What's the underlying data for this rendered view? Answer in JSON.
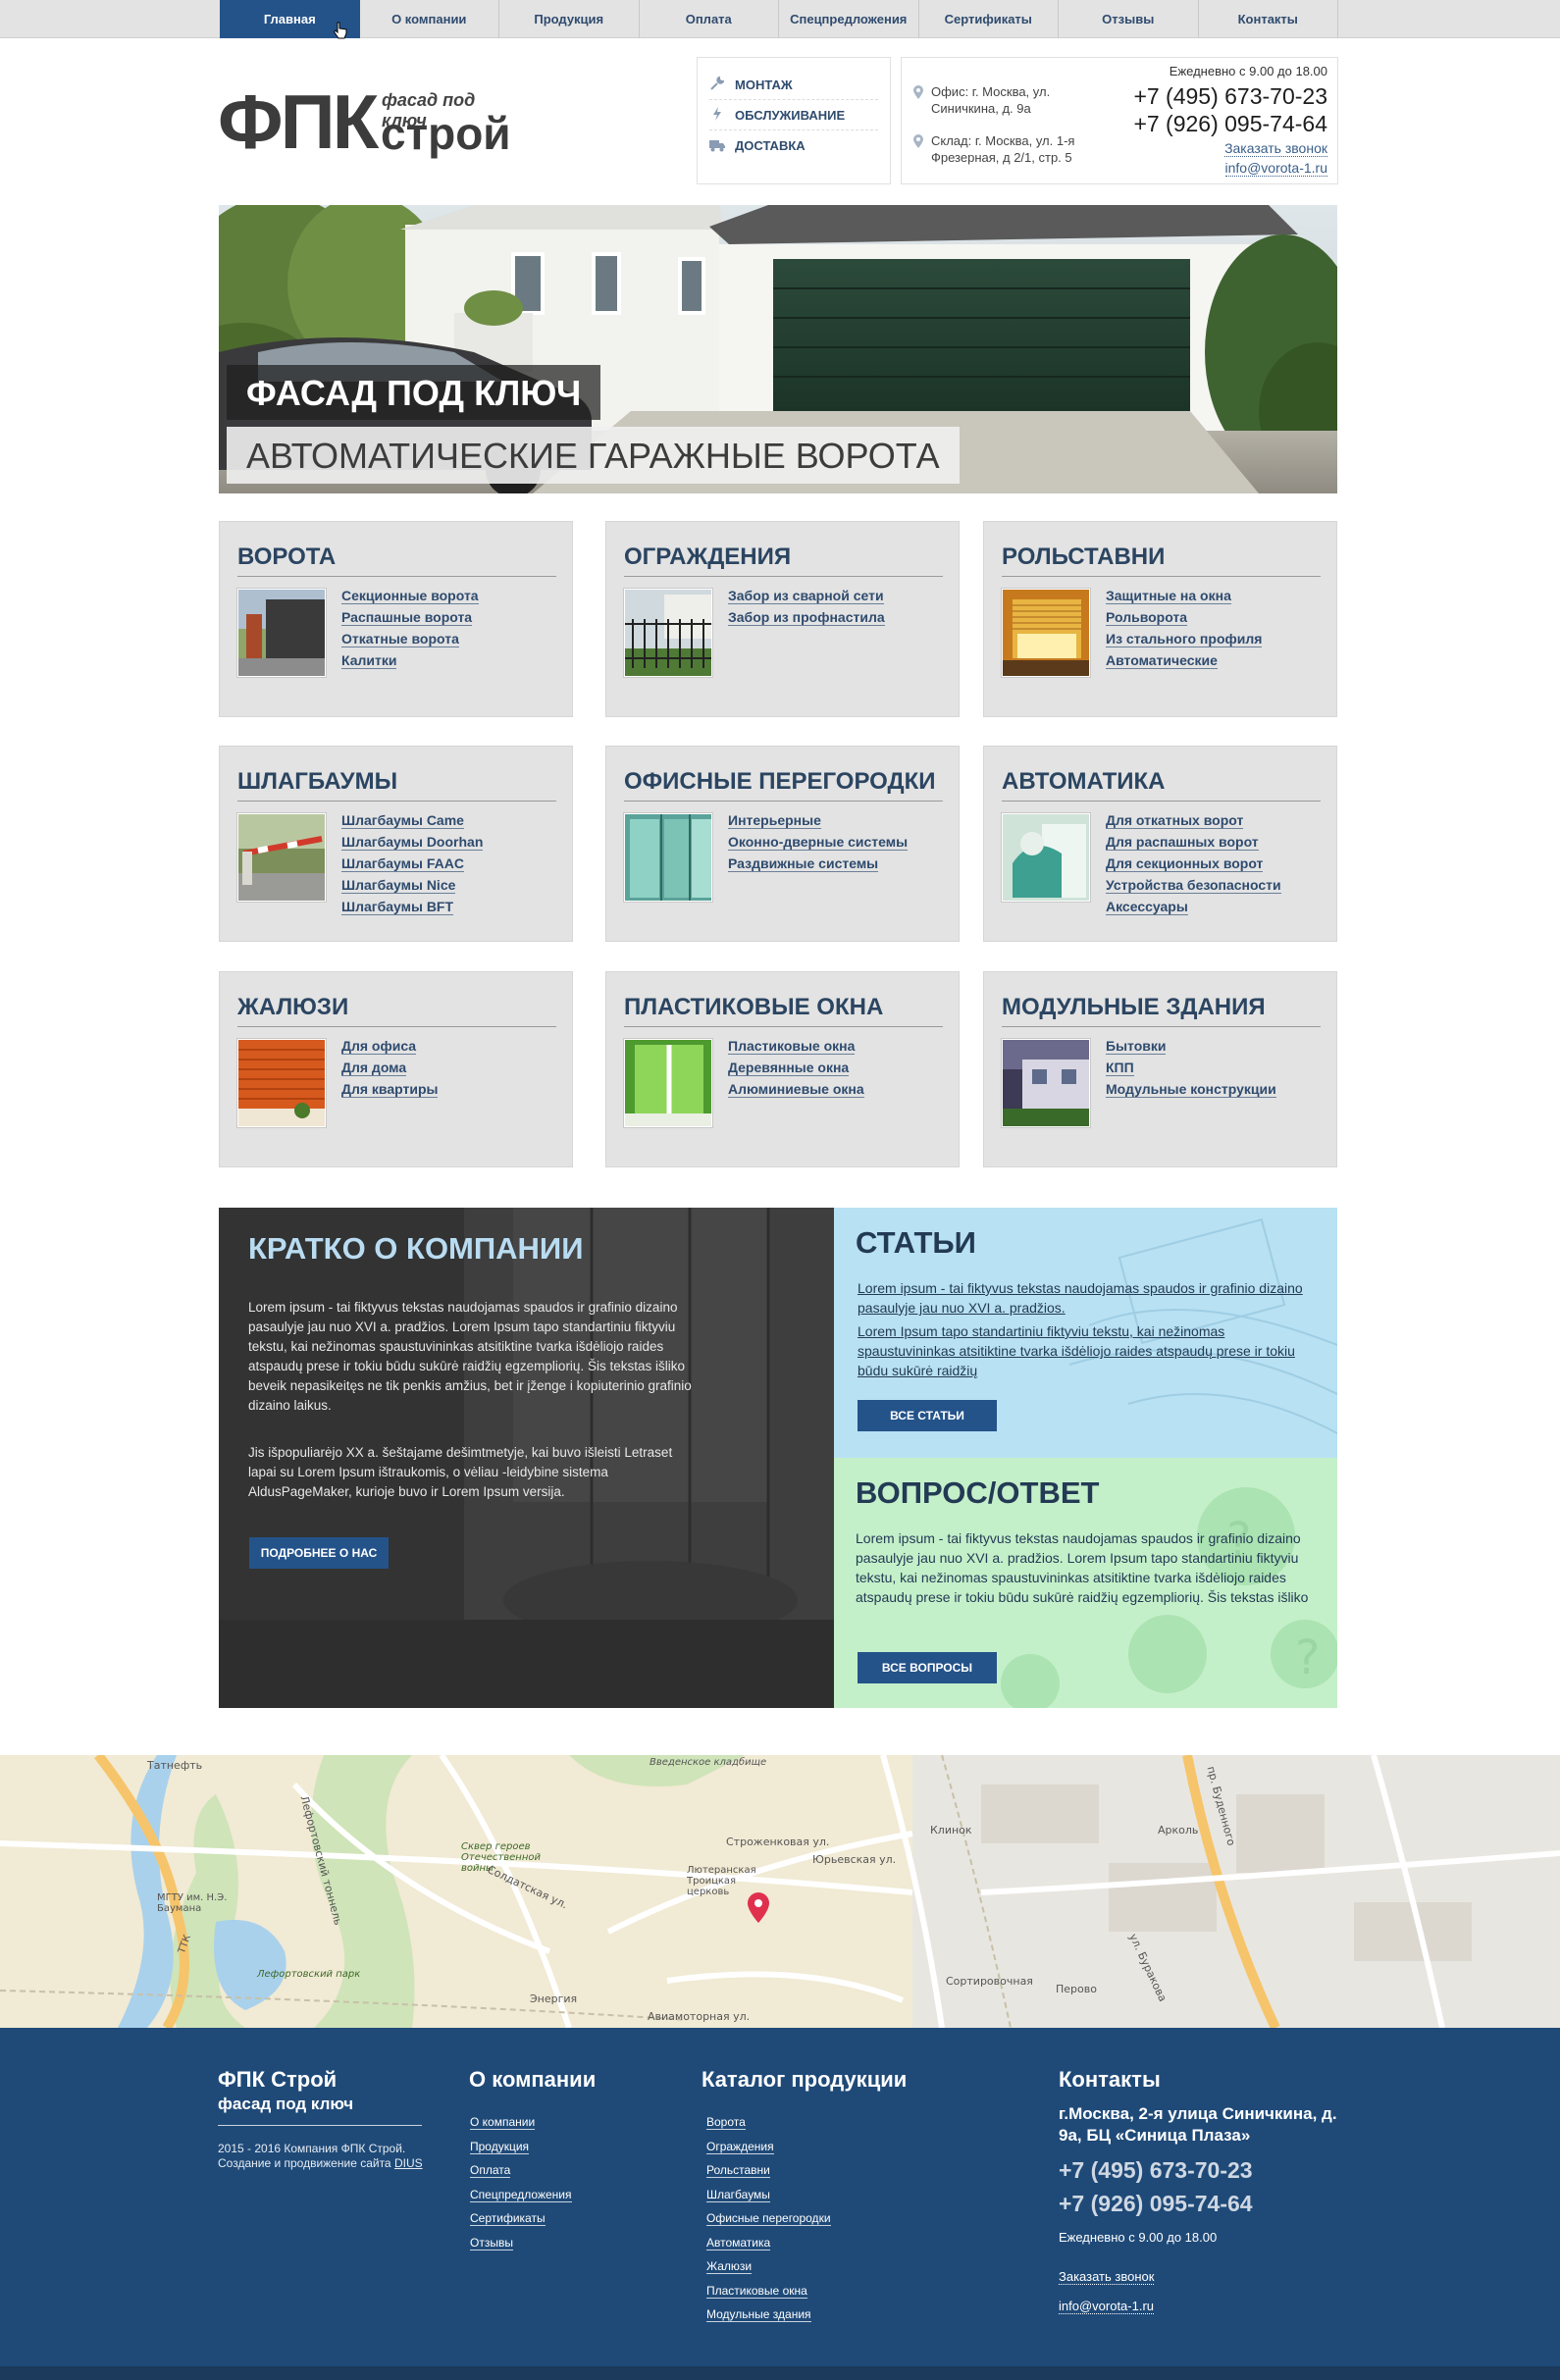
{
  "nav": {
    "items": [
      "Главная",
      "О компании",
      "Продукция",
      "Оплата",
      "Спецпредложения",
      "Сертификаты",
      "Отзывы",
      "Контакты"
    ]
  },
  "logo": {
    "main": "ФПК",
    "sub": "фасад под ключ",
    "stroy": "строй"
  },
  "services": {
    "items": [
      {
        "label": "МОНТАЖ",
        "icon": "wrench-icon"
      },
      {
        "label": "ОБСЛУЖИВАНИЕ",
        "icon": "lightning-icon"
      },
      {
        "label": "ДОСТАВКА",
        "icon": "truck-icon"
      }
    ]
  },
  "header_contacts": {
    "office": "Офис: г. Москва, ул. Синичкина, д. 9а",
    "warehouse": "Склад: г. Москва, ул. 1-я Фрезерная, д 2/1, стр. 5",
    "hours": "Ежедневно с 9.00 до 18.00",
    "phone1": "+7 (495) 673-70-23",
    "phone2": "+7 (926) 095-74-64",
    "call_link": "Заказать звонок",
    "email": "info@vorota-1.ru"
  },
  "hero": {
    "title": "ФАСАД ПОД КЛЮЧ",
    "subtitle": "АВТОМАТИЧЕСКИЕ ГАРАЖНЫЕ ВОРОТА"
  },
  "categories": [
    {
      "title": "ВОРОТА",
      "links": [
        "Секционные ворота",
        "Распашные ворота",
        "Откатные ворота",
        "Калитки"
      ]
    },
    {
      "title": "ОГРАЖДЕНИЯ",
      "links": [
        "Забор из сварной сети",
        "Забор из профнастила"
      ]
    },
    {
      "title": "РОЛЬСТАВНИ",
      "links": [
        "Защитные на окна",
        "Рольворота",
        "Из стального профиля",
        "Автоматические"
      ]
    },
    {
      "title": "ШЛАГБАУМЫ",
      "links": [
        "Шлагбаумы Came",
        "Шлагбаумы Doorhan",
        "Шлагбаумы FAAC",
        "Шлагбаумы Nice",
        "Шлагбаумы BFT"
      ]
    },
    {
      "title": "ОФИСНЫЕ ПЕРЕГОРОДКИ",
      "links": [
        "Интерьерные",
        "Оконно-дверные системы",
        "Раздвижные системы"
      ]
    },
    {
      "title": "АВТОМАТИКА",
      "links": [
        "Для откатных ворот",
        "Для распашных ворот",
        "Для секционных ворот",
        "Устройства безопасности",
        "Аксессуары"
      ]
    },
    {
      "title": "ЖАЛЮЗИ",
      "links": [
        "Для офиса",
        "Для дома",
        "Для квартиры"
      ]
    },
    {
      "title": "ПЛАСТИКОВЫЕ ОКНА",
      "links": [
        "Пластиковые окна",
        "Деревянные окна",
        "Алюминиевые окна"
      ]
    },
    {
      "title": "МОДУЛЬНЫЕ ЗДАНИЯ",
      "links": [
        "Бытовки",
        "КПП",
        "Модульные конструкции"
      ]
    }
  ],
  "about": {
    "title": "КРАТКО О КОМПАНИИ",
    "p1": "Lorem ipsum - tai fiktyvus tekstas naudojamas spaudos ir grafinio dizaino pasaulyje jau nuo XVI a. pradžios. Lorem Ipsum tapo standartiniu fiktyviu tekstu, kai nežinomas spaustuvininkas atsitiktine tvarka išdėliojo raides atspaudų prese ir tokiu būdu sukūrė raidžių egzempliorių. Šis tekstas išliko beveik nepasikeitęs ne tik penkis amžius, bet ir įženge i kopiuterinio grafinio dizaino laikus.",
    "p2": "Jis išpopuliarėjo XX a. šeštajame dešimtmetyje, kai buvo išleisti Letraset lapai su Lorem Ipsum ištraukomis, o vėliau -leidybine sistema AldusPageMaker, kurioje buvo ir Lorem Ipsum versija.",
    "button": "ПОДРОБНЕЕ О НАС"
  },
  "articles": {
    "title": "СТАТЬИ",
    "link1": "Lorem ipsum - tai fiktyvus tekstas naudojamas spaudos ir grafinio dizaino pasaulyje jau nuo XVI a. pradžios.",
    "link2": "Lorem Ipsum tapo standartiniu fiktyviu tekstu, kai nežinomas spaustuvininkas atsitiktine tvarka išdėliojo raides atspaudų prese ir tokiu būdu sukūrė raidžių",
    "button": "ВСЕ СТАТЬИ"
  },
  "faq": {
    "title": "ВОПРОС/ОТВЕТ",
    "text": "Lorem ipsum - tai fiktyvus tekstas naudojamas spaudos ir grafinio dizaino pasaulyje jau nuo XVI a. pradžios. Lorem Ipsum tapo standartiniu fiktyviu tekstu, kai nežinomas spaustuvininkas atsitiktine tvarka išdėliojo raides atspaudų prese ir tokiu būdu sukūrė raidžių egzempliorių. Šis tekstas išliko",
    "button": "ВСЕ ВОПРОСЫ"
  },
  "map": {
    "labels": [
      "Татнефть",
      "МГТУ им. Н.Э. Баумана",
      "Лефортовский парк",
      "Лефортовский тоннель",
      "Сквер героев Отечественной войны",
      "Лютеранская Троицкая церковь",
      "Введенское кладбище",
      "Клинок",
      "Арколь",
      "Сортировочная",
      "Перово",
      "Энергия",
      "Юрьевская ул.",
      "Строженковая ул.",
      "Солдатская ул.",
      "Авиамоторная ул.",
      "ул. Буракова",
      "пр. Буденного",
      "ТТК"
    ]
  },
  "footer": {
    "brand": "ФПК Строй",
    "brand_sub": "фасад под ключ",
    "copyright": "2015 - 2016 Компания ФПК Строй.",
    "dev_prefix": "Создание и продвижение сайта",
    "dev_link": "DIUS",
    "about_title": "О компании",
    "about_links": [
      "О компании",
      "Продукция",
      "Оплата",
      "Спецпредложения",
      "Сертификаты",
      "Отзывы"
    ],
    "catalog_title": "Каталог продукции",
    "catalog_links": [
      "Ворота",
      "Ограждения",
      "Рольставни",
      "Шлагбаумы",
      "Офисные перегородки",
      "Автоматика",
      "Жалюзи",
      "Пластиковые окна",
      "Модульные здания"
    ],
    "contacts_title": "Контакты",
    "address": "г.Москва, 2-я улица Синичкина, д. 9а, БЦ «Синица Плаза»",
    "phone1": "+7 (495) 673-70-23",
    "phone2": "+7 (926) 095-74-64",
    "hours": "Ежедневно с 9.00 до 18.00",
    "call_link": "Заказать звонок",
    "email": "info@vorota-1.ru"
  },
  "colors": {
    "accent": "#24538a",
    "footer": "#1f4a78",
    "tile": "#e3e3e3",
    "title": "#2b4561"
  }
}
